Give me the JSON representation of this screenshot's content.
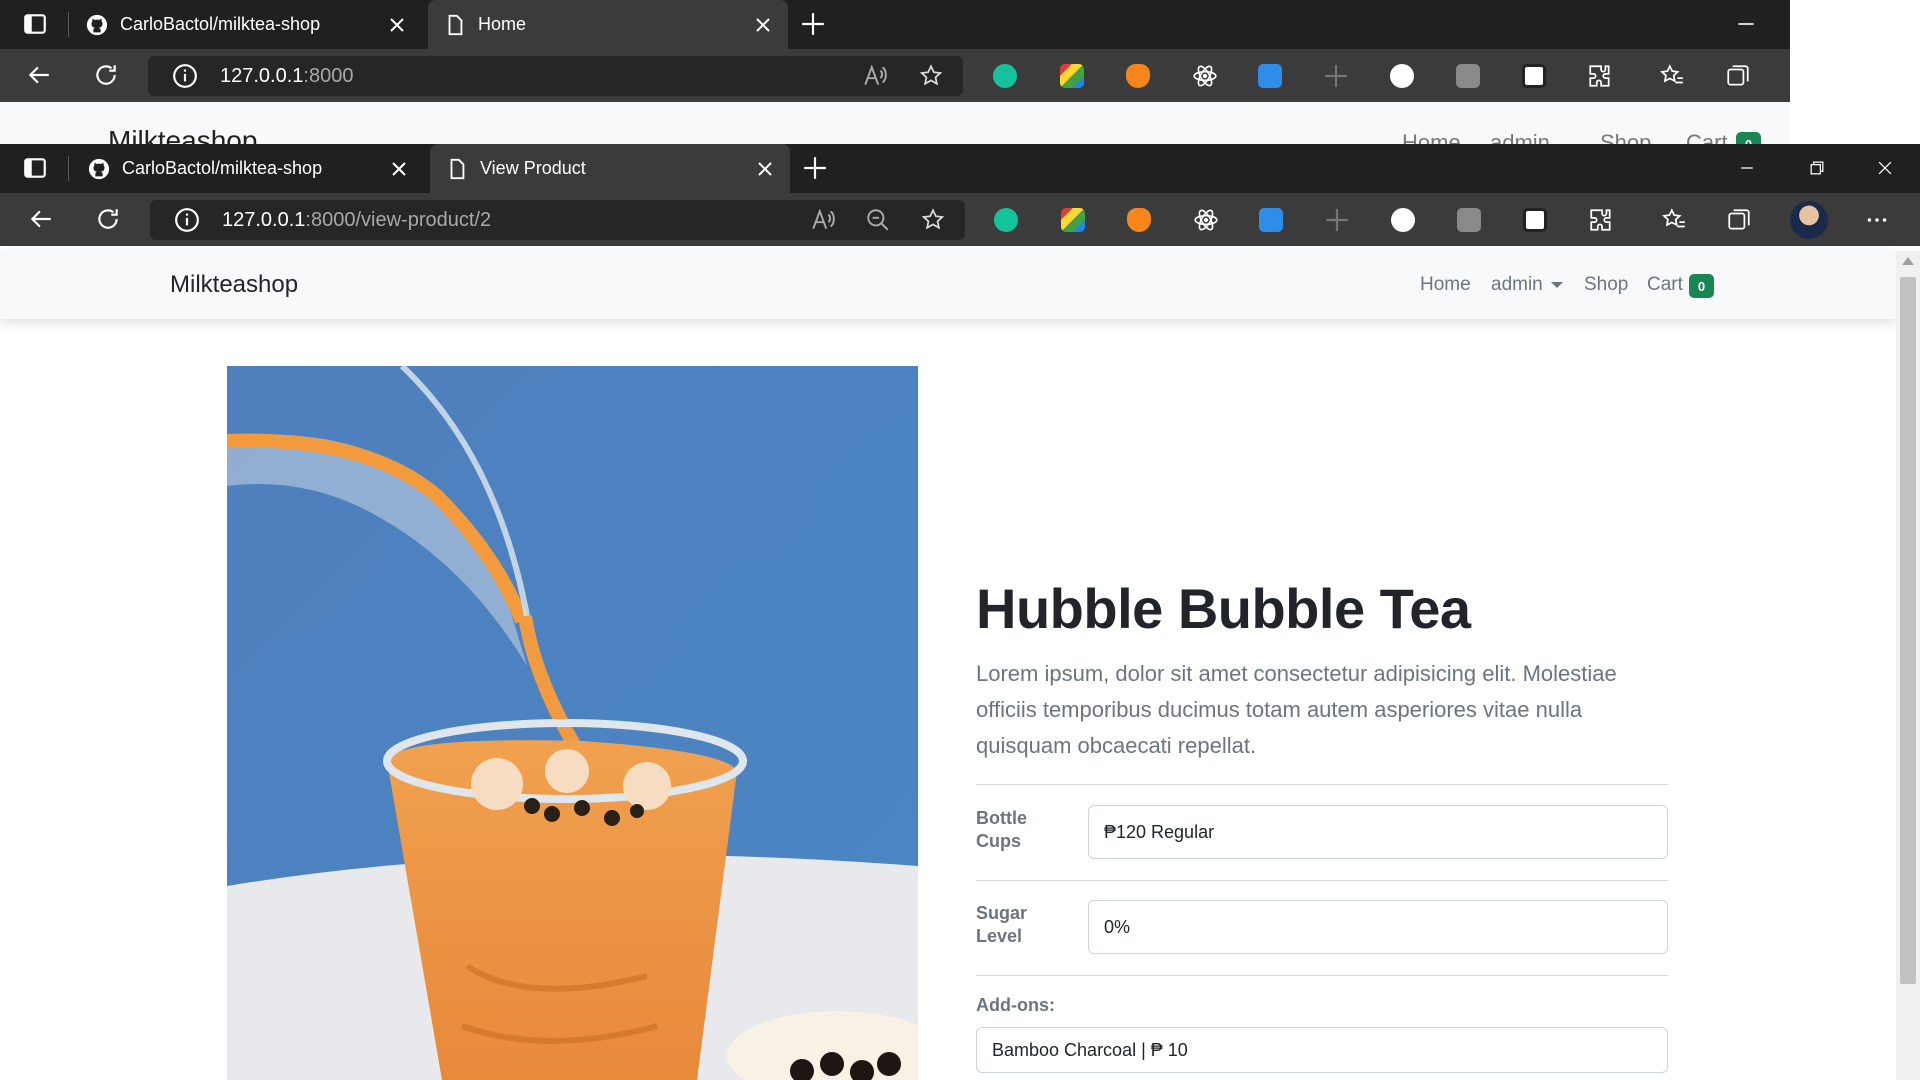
{
  "back_window": {
    "tabs": [
      {
        "label": "CarloBactol/milktea-shop"
      },
      {
        "label": "Home"
      }
    ],
    "address": {
      "host": "127.0.0.1",
      "rest": ":8000"
    },
    "page": {
      "brand": "Milkteashop",
      "nav": [
        "Home",
        "admin",
        "Shop",
        "Cart"
      ],
      "cart_count": "0"
    }
  },
  "front_window": {
    "tabs": [
      {
        "label": "CarloBactol/milktea-shop"
      },
      {
        "label": "View Product"
      }
    ],
    "address": {
      "host": "127.0.0.1",
      "rest": ":8000/view-product/2"
    }
  },
  "navbar": {
    "brand": "Milkteashop",
    "home": "Home",
    "admin": "admin",
    "shop": "Shop",
    "cart": "Cart",
    "cart_count": "0"
  },
  "product": {
    "title": "Hubble Bubble Tea",
    "description": "Lorem ipsum, dolor sit amet consectetur adipisicing elit. Molestiae officiis temporibus ducimus totam autem asperiores vitae nulla quisquam obcaecati repellat.",
    "fields": {
      "bottle_label": "Bottle Cups",
      "bottle_value": "₱120 Regular",
      "sugar_label": "Sugar Level",
      "sugar_value": "0%",
      "addons_label": "Add-ons:",
      "addons_value": "Bamboo Charcoal | ₱ 10"
    }
  },
  "colors": {
    "chrome_dark": "#202020",
    "toolbar": "#3b3b3b",
    "badge": "#198754",
    "title": "#212529",
    "muted": "#6c757d"
  }
}
